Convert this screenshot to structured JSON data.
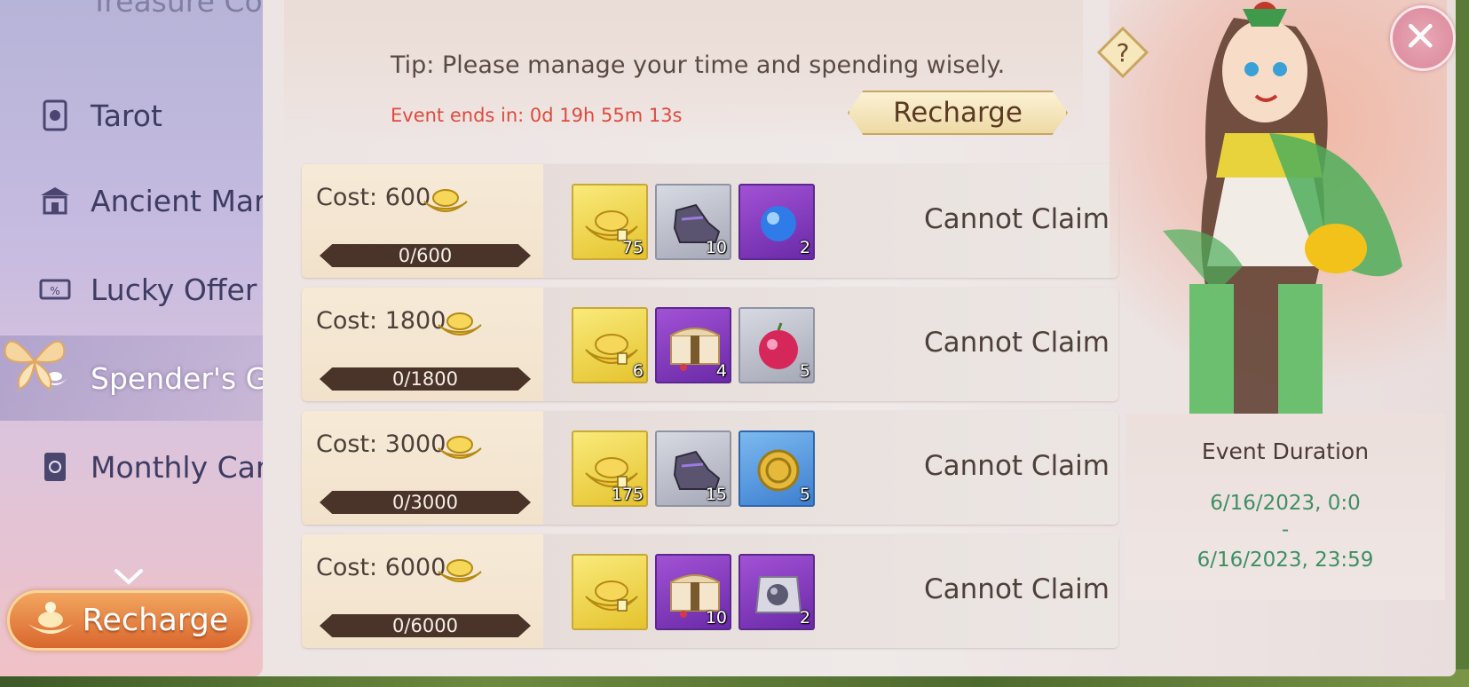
{
  "nav": {
    "top_partial": "Treasure Compass",
    "items": [
      {
        "label": "Tarot",
        "icon": "tarot-icon"
      },
      {
        "label": "Ancient Market",
        "icon": "market-icon"
      },
      {
        "label": "Lucky Offer",
        "icon": "ticket-icon"
      },
      {
        "label": "Spender's Gift",
        "icon": "ingot-icon",
        "active": true
      },
      {
        "label": "Monthly Card",
        "icon": "card-icon"
      }
    ],
    "recharge_label": "Recharge"
  },
  "header": {
    "tip": "Tip: Please manage your time and spending wisely.",
    "countdown": "Event ends in: 0d 19h 55m 13s",
    "recharge_label": "Recharge"
  },
  "tiers": [
    {
      "cost": "Cost: 600",
      "progress": "0/600",
      "status": "Cannot Claim",
      "rewards": [
        {
          "icon": "gold-ingot-icon",
          "qty": "75",
          "style": "gold"
        },
        {
          "icon": "boots-icon",
          "qty": "10",
          "style": "grey"
        },
        {
          "icon": "blue-orb-icon",
          "qty": "2",
          "style": "purple"
        }
      ]
    },
    {
      "cost": "Cost: 1800",
      "progress": "0/1800",
      "status": "Cannot Claim",
      "rewards": [
        {
          "icon": "gold-ingot-icon",
          "qty": "6",
          "style": "gold"
        },
        {
          "icon": "treasure-chest-icon",
          "qty": "4",
          "style": "purple"
        },
        {
          "icon": "red-fruit-icon",
          "qty": "5",
          "style": "grey"
        }
      ]
    },
    {
      "cost": "Cost: 3000",
      "progress": "0/3000",
      "status": "Cannot Claim",
      "rewards": [
        {
          "icon": "gold-ingot-icon",
          "qty": "175",
          "style": "gold"
        },
        {
          "icon": "boots-icon",
          "qty": "15",
          "style": "grey"
        },
        {
          "icon": "gold-coin-icon",
          "qty": "5",
          "style": "blue"
        }
      ]
    },
    {
      "cost": "Cost: 6000",
      "progress": "0/6000",
      "status": "Cannot Claim",
      "rewards": [
        {
          "icon": "gold-ingot-icon",
          "qty": "",
          "style": "gold"
        },
        {
          "icon": "treasure-chest-icon",
          "qty": "10",
          "style": "purple"
        },
        {
          "icon": "crystal-pouch-icon",
          "qty": "2",
          "style": "purple"
        }
      ]
    }
  ],
  "duration": {
    "title": "Event Duration",
    "start": "6/16/2023, 0:0",
    "separator": "-",
    "end": "6/16/2023, 23:59"
  },
  "colors": {
    "countdown": "#e04a3c",
    "duration_dates": "#3f8f64",
    "progress_bar": "#4a3429"
  }
}
